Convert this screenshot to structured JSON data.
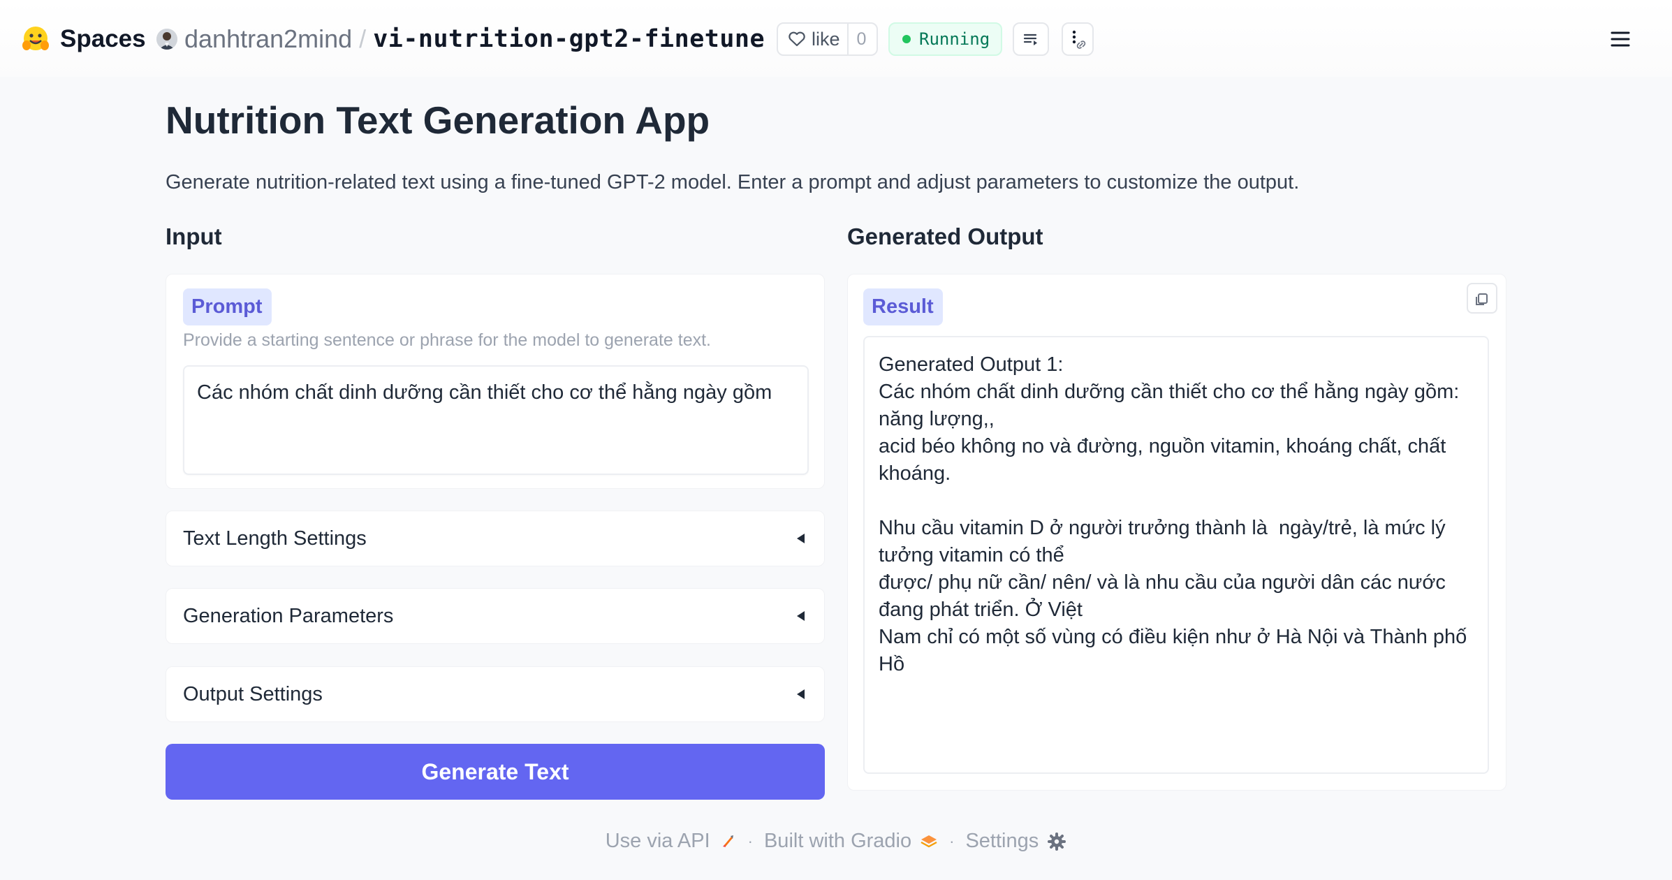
{
  "header": {
    "brand": "Spaces",
    "owner": "danhtran2mind",
    "separator": "/",
    "repo_name": "vi-nutrition-gpt2-finetune",
    "like_label": "like",
    "like_count": "0",
    "status": "Running",
    "status_color": "#22c55e"
  },
  "page": {
    "title": "Nutrition Text Generation App",
    "description": "Generate nutrition-related text using a fine-tuned GPT-2 model. Enter a prompt and adjust parameters to customize the output."
  },
  "input": {
    "heading": "Input",
    "prompt_label": "Prompt",
    "prompt_hint": "Provide a starting sentence or phrase for the model to generate text.",
    "prompt_value": "Các nhóm chất dinh dưỡng cần thiết cho cơ thể hằng ngày gồm",
    "accordions": [
      {
        "label": "Text Length Settings"
      },
      {
        "label": "Generation Parameters"
      },
      {
        "label": "Output Settings"
      }
    ],
    "generate_button": "Generate Text",
    "accent": "#6366f1"
  },
  "output": {
    "heading": "Generated Output",
    "result_label": "Result",
    "result_text": "Generated Output 1:\nCác nhóm chất dinh dưỡng cần thiết cho cơ thể hằng ngày gồm: năng lượng,,\nacid béo không no và đường, nguồn vitamin, khoáng chất, chất khoáng.\n\nNhu cầu vitamin D ở người trưởng thành là  ngày/trẻ, là mức lý tưởng vitamin có thể\nđược/ phụ nữ cần/ nên/ và là nhu cầu của người dân các nước đang phát triển. Ở Việt\nNam chỉ có một số vùng có điều kiện như ở Hà Nội và Thành phố Hồ"
  },
  "footer": {
    "api": "Use via API",
    "built": "Built with Gradio",
    "settings": "Settings",
    "dot": "·"
  }
}
